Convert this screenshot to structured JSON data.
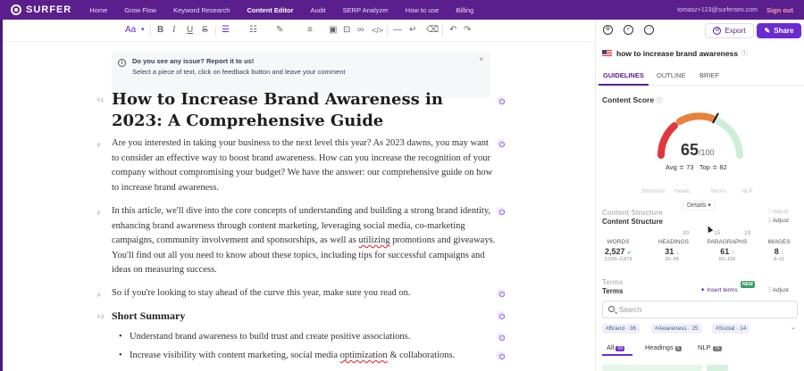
{
  "nav": {
    "logo": "SURFER",
    "links": [
      "Home",
      "Grow Flow",
      "Keyword Research",
      "Content Editor",
      "Audit",
      "SERP Analyzer",
      "How to use",
      "Billing"
    ],
    "active_index": 3,
    "user_email": "tomasz+123@surferseo.com",
    "sign_out": "Sign out"
  },
  "toolbar": {
    "font": "Aa",
    "bold": "B",
    "italic": "I",
    "underline": "U",
    "strike": "S",
    "undo": "↶",
    "redo": "↷"
  },
  "notice": {
    "title": "Do you see any issue? Report it to us!",
    "body": "Select a piece of text, click on feedback button and leave your comment",
    "close": "×"
  },
  "doc": {
    "tags": {
      "h1": "h1",
      "p": "p",
      "h3": "h3"
    },
    "h1": "How to Increase Brand Awareness in 2023: A Comprehensive Guide",
    "p1": "Are you interested in taking your business to the next level this year? As 2023 dawns, you may want to consider an effective way to boost brand awareness. How can you increase the recognition of your company without compromising your budget? We have the answer: our comprehensive guide on how to increase brand awareness.",
    "p2_before": "In this article, we'll dive into the core concepts of understanding and building a strong brand identity, enhancing brand awareness through content marketing, leveraging social media, co-marketing campaigns, community involvement and sponsorships, as well as ",
    "p2_underlined": "utilizing",
    "p2_after": " promotions and giveaways. You'll find out all you need to know about these topics, including tips for successful campaigns and ideas on measuring success.",
    "p3": "So if you're looking to stay ahead of the curve this year, make sure you read on.",
    "h3": "Short Summary",
    "b1": "Understand brand awareness to build trust and create positive associations.",
    "b2_before": "Increase visibility with content marketing, social media ",
    "b2_underlined": "optimization",
    "b2_after": " & collaborations."
  },
  "sidebar": {
    "export": "Export",
    "share": "Share",
    "keyword": "how to increase brand awareness",
    "tabs": [
      "GUIDELINES",
      "OUTLINE",
      "BRIEF"
    ],
    "content_score_title": "Content Score",
    "score": "65",
    "score_max": "/100",
    "avg": "Avg ≑ 73",
    "top": "Top ≑ 82",
    "ghost_columns": [
      "Structure",
      "Headi..",
      "Terms",
      "NLP"
    ],
    "ghost_nums": [
      "20",
      "15",
      "19"
    ],
    "details": "Details",
    "content_structure": "Content Structure",
    "adjust": "Adjust",
    "stats": [
      {
        "label": "WORDS",
        "value": "2,527",
        "range": "2,500–2,873"
      },
      {
        "label": "HEADINGS",
        "value": "31",
        "range": "25–28"
      },
      {
        "label": "PARAGRAPHS",
        "value": "61",
        "range": "83–100"
      },
      {
        "label": "IMAGES",
        "value": "8",
        "range": "9–11"
      }
    ],
    "terms": "Terms",
    "insert_terms": "Insert terms",
    "new_badge": "NEW",
    "search_placeholder": "Search",
    "chips": [
      "#Brand · 36",
      "#Awareness · 25",
      "#Social · 14"
    ],
    "filters": [
      {
        "label": "All",
        "count": "60"
      },
      {
        "label": "Headings",
        "count": "5"
      },
      {
        "label": "NLP",
        "count": "75"
      }
    ]
  },
  "colors": {
    "nav_bg": "#5a1f8c",
    "accent": "#6b2bd0",
    "gauge_red": "#e0383e",
    "gauge_orange": "#e8823a",
    "gauge_green": "#b9e3c6"
  }
}
